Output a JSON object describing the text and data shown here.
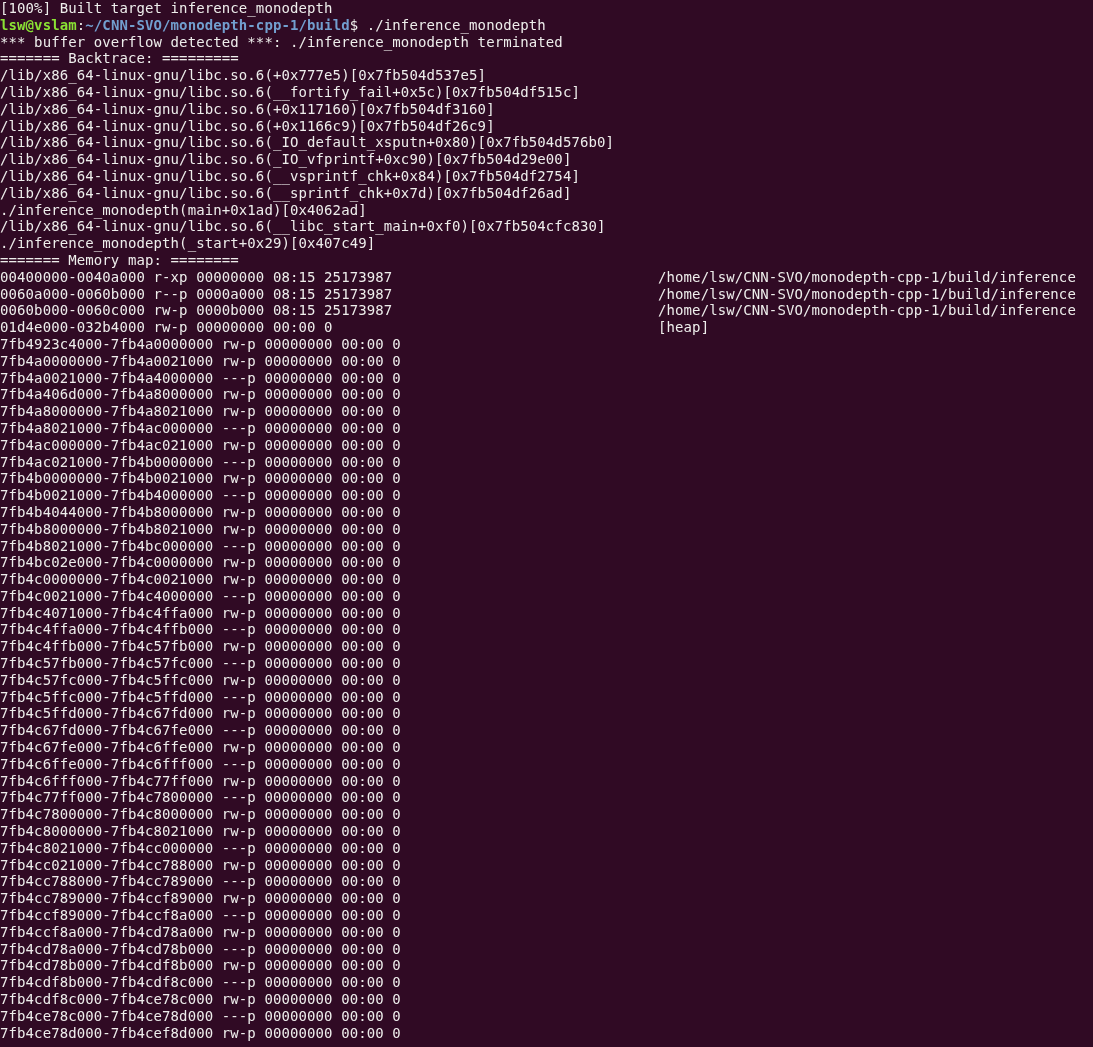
{
  "terminal": {
    "lines": [
      {
        "kind": "text",
        "text": "[100%] Built target inference_monodepth"
      },
      {
        "kind": "prompt",
        "user_host": "lsw@vslam",
        "separator": ":",
        "path": "~/CNN-SVO/monodepth-cpp-1/build",
        "command": "$ ./inference_monodepth"
      },
      {
        "kind": "text",
        "text": "*** buffer overflow detected ***: ./inference_monodepth terminated"
      },
      {
        "kind": "text",
        "text": "======= Backtrace: ========="
      },
      {
        "kind": "text",
        "text": "/lib/x86_64-linux-gnu/libc.so.6(+0x777e5)[0x7fb504d537e5]"
      },
      {
        "kind": "text",
        "text": "/lib/x86_64-linux-gnu/libc.so.6(__fortify_fail+0x5c)[0x7fb504df515c]"
      },
      {
        "kind": "text",
        "text": "/lib/x86_64-linux-gnu/libc.so.6(+0x117160)[0x7fb504df3160]"
      },
      {
        "kind": "text",
        "text": "/lib/x86_64-linux-gnu/libc.so.6(+0x1166c9)[0x7fb504df26c9]"
      },
      {
        "kind": "text",
        "text": "/lib/x86_64-linux-gnu/libc.so.6(_IO_default_xsputn+0x80)[0x7fb504d576b0]"
      },
      {
        "kind": "text",
        "text": "/lib/x86_64-linux-gnu/libc.so.6(_IO_vfprintf+0xc90)[0x7fb504d29e00]"
      },
      {
        "kind": "text",
        "text": "/lib/x86_64-linux-gnu/libc.so.6(__vsprintf_chk+0x84)[0x7fb504df2754]"
      },
      {
        "kind": "text",
        "text": "/lib/x86_64-linux-gnu/libc.so.6(__sprintf_chk+0x7d)[0x7fb504df26ad]"
      },
      {
        "kind": "text",
        "text": "./inference_monodepth(main+0x1ad)[0x4062ad]"
      },
      {
        "kind": "text",
        "text": "/lib/x86_64-linux-gnu/libc.so.6(__libc_start_main+0xf0)[0x7fb504cfc830]"
      },
      {
        "kind": "text",
        "text": "./inference_monodepth(_start+0x29)[0x407c49]"
      },
      {
        "kind": "text",
        "text": "======= Memory map: ========"
      },
      {
        "kind": "map",
        "text": "00400000-0040a000 r-xp 00000000 08:15 25173987",
        "path": "/home/lsw/CNN-SVO/monodepth-cpp-1/build/inference"
      },
      {
        "kind": "map",
        "text": "0060a000-0060b000 r--p 0000a000 08:15 25173987",
        "path": "/home/lsw/CNN-SVO/monodepth-cpp-1/build/inference"
      },
      {
        "kind": "map",
        "text": "0060b000-0060c000 rw-p 0000b000 08:15 25173987",
        "path": "/home/lsw/CNN-SVO/monodepth-cpp-1/build/inference"
      },
      {
        "kind": "map",
        "text": "01d4e000-032b4000 rw-p 00000000 00:00 0",
        "path": "[heap]"
      },
      {
        "kind": "text",
        "text": "7fb4923c4000-7fb4a0000000 rw-p 00000000 00:00 0"
      },
      {
        "kind": "text",
        "text": "7fb4a0000000-7fb4a0021000 rw-p 00000000 00:00 0"
      },
      {
        "kind": "text",
        "text": "7fb4a0021000-7fb4a4000000 ---p 00000000 00:00 0"
      },
      {
        "kind": "text",
        "text": "7fb4a406d000-7fb4a8000000 rw-p 00000000 00:00 0"
      },
      {
        "kind": "text",
        "text": "7fb4a8000000-7fb4a8021000 rw-p 00000000 00:00 0"
      },
      {
        "kind": "text",
        "text": "7fb4a8021000-7fb4ac000000 ---p 00000000 00:00 0"
      },
      {
        "kind": "text",
        "text": "7fb4ac000000-7fb4ac021000 rw-p 00000000 00:00 0"
      },
      {
        "kind": "text",
        "text": "7fb4ac021000-7fb4b0000000 ---p 00000000 00:00 0"
      },
      {
        "kind": "text",
        "text": "7fb4b0000000-7fb4b0021000 rw-p 00000000 00:00 0"
      },
      {
        "kind": "text",
        "text": "7fb4b0021000-7fb4b4000000 ---p 00000000 00:00 0"
      },
      {
        "kind": "text",
        "text": "7fb4b4044000-7fb4b8000000 rw-p 00000000 00:00 0"
      },
      {
        "kind": "text",
        "text": "7fb4b8000000-7fb4b8021000 rw-p 00000000 00:00 0"
      },
      {
        "kind": "text",
        "text": "7fb4b8021000-7fb4bc000000 ---p 00000000 00:00 0"
      },
      {
        "kind": "text",
        "text": "7fb4bc02e000-7fb4c0000000 rw-p 00000000 00:00 0"
      },
      {
        "kind": "text",
        "text": "7fb4c0000000-7fb4c0021000 rw-p 00000000 00:00 0"
      },
      {
        "kind": "text",
        "text": "7fb4c0021000-7fb4c4000000 ---p 00000000 00:00 0"
      },
      {
        "kind": "text",
        "text": "7fb4c4071000-7fb4c4ffa000 rw-p 00000000 00:00 0"
      },
      {
        "kind": "text",
        "text": "7fb4c4ffa000-7fb4c4ffb000 ---p 00000000 00:00 0"
      },
      {
        "kind": "text",
        "text": "7fb4c4ffb000-7fb4c57fb000 rw-p 00000000 00:00 0"
      },
      {
        "kind": "text",
        "text": "7fb4c57fb000-7fb4c57fc000 ---p 00000000 00:00 0"
      },
      {
        "kind": "text",
        "text": "7fb4c57fc000-7fb4c5ffc000 rw-p 00000000 00:00 0"
      },
      {
        "kind": "text",
        "text": "7fb4c5ffc000-7fb4c5ffd000 ---p 00000000 00:00 0"
      },
      {
        "kind": "text",
        "text": "7fb4c5ffd000-7fb4c67fd000 rw-p 00000000 00:00 0"
      },
      {
        "kind": "text",
        "text": "7fb4c67fd000-7fb4c67fe000 ---p 00000000 00:00 0"
      },
      {
        "kind": "text",
        "text": "7fb4c67fe000-7fb4c6ffe000 rw-p 00000000 00:00 0"
      },
      {
        "kind": "text",
        "text": "7fb4c6ffe000-7fb4c6fff000 ---p 00000000 00:00 0"
      },
      {
        "kind": "text",
        "text": "7fb4c6fff000-7fb4c77ff000 rw-p 00000000 00:00 0"
      },
      {
        "kind": "text",
        "text": "7fb4c77ff000-7fb4c7800000 ---p 00000000 00:00 0"
      },
      {
        "kind": "text",
        "text": "7fb4c7800000-7fb4c8000000 rw-p 00000000 00:00 0"
      },
      {
        "kind": "text",
        "text": "7fb4c8000000-7fb4c8021000 rw-p 00000000 00:00 0"
      },
      {
        "kind": "text",
        "text": "7fb4c8021000-7fb4cc000000 ---p 00000000 00:00 0"
      },
      {
        "kind": "text",
        "text": "7fb4cc021000-7fb4cc788000 rw-p 00000000 00:00 0"
      },
      {
        "kind": "text",
        "text": "7fb4cc788000-7fb4cc789000 ---p 00000000 00:00 0"
      },
      {
        "kind": "text",
        "text": "7fb4cc789000-7fb4ccf89000 rw-p 00000000 00:00 0"
      },
      {
        "kind": "text",
        "text": "7fb4ccf89000-7fb4ccf8a000 ---p 00000000 00:00 0"
      },
      {
        "kind": "text",
        "text": "7fb4ccf8a000-7fb4cd78a000 rw-p 00000000 00:00 0"
      },
      {
        "kind": "text",
        "text": "7fb4cd78a000-7fb4cd78b000 ---p 00000000 00:00 0"
      },
      {
        "kind": "text",
        "text": "7fb4cd78b000-7fb4cdf8b000 rw-p 00000000 00:00 0"
      },
      {
        "kind": "text",
        "text": "7fb4cdf8b000-7fb4cdf8c000 ---p 00000000 00:00 0"
      },
      {
        "kind": "text",
        "text": "7fb4cdf8c000-7fb4ce78c000 rw-p 00000000 00:00 0"
      },
      {
        "kind": "text",
        "text": "7fb4ce78c000-7fb4ce78d000 ---p 00000000 00:00 0"
      },
      {
        "kind": "text",
        "text": "7fb4ce78d000-7fb4cef8d000 rw-p 00000000 00:00 0"
      }
    ]
  }
}
